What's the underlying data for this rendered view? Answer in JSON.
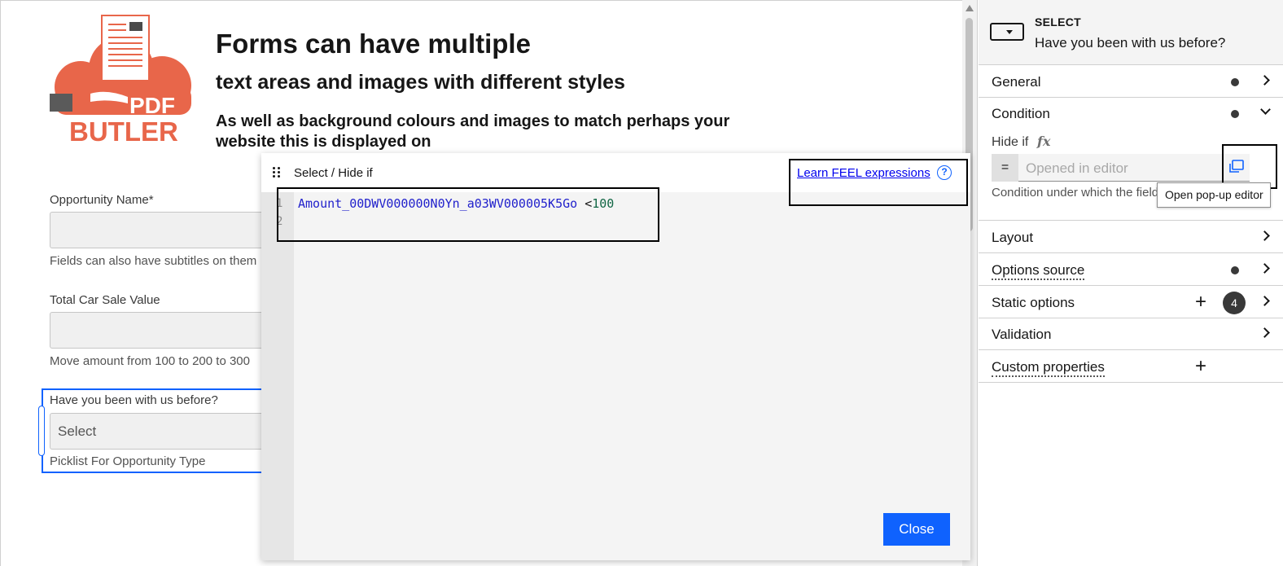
{
  "canvas": {
    "logo": {
      "top_text": "PDF",
      "bottom_text": "BUTLER",
      "colors": {
        "brand": "#e8664a",
        "dark": "#5a5a5a"
      }
    },
    "heading_1": "Forms can have multiple",
    "heading_2": "text areas and images with different styles",
    "heading_3": "As well as background colours and images to match perhaps your website this is displayed on",
    "fields": [
      {
        "label": "Opportunity Name*",
        "description": "Fields can also have subtitles on them"
      },
      {
        "label": "Total Car Sale Value",
        "description": "Move amount from 100 to 200 to 300"
      },
      {
        "label": "Have you been with us before?",
        "value": "Select",
        "description": "Picklist For Opportunity Type"
      }
    ]
  },
  "modal": {
    "title": "Select / Hide if",
    "help_link": "Learn FEEL expressions",
    "help_icon": "question-circle-icon",
    "line_numbers": [
      "1",
      "2"
    ],
    "code": {
      "variable": "Amount_00DWV000000N0Yn_a03WV000005K5Go",
      "operator": " <",
      "number": "100"
    },
    "close_label": "Close"
  },
  "panel": {
    "element_type": "SELECT",
    "element_label": "Have you been with us before?",
    "groups": {
      "general": "General",
      "condition": "Condition",
      "layout": "Layout",
      "options_source": "Options source",
      "static_options": "Static options",
      "static_options_count": "4",
      "validation": "Validation",
      "custom_properties": "Custom properties"
    },
    "condition": {
      "hide_if_label": "Hide if",
      "fx": "fx",
      "equals": "=",
      "placeholder": "Opened in editor",
      "description": "Condition under which the field is hidden"
    },
    "tooltip": "Open pop-up editor"
  },
  "colors": {
    "accent": "#0f62fe",
    "highlight_box": "#000000"
  }
}
